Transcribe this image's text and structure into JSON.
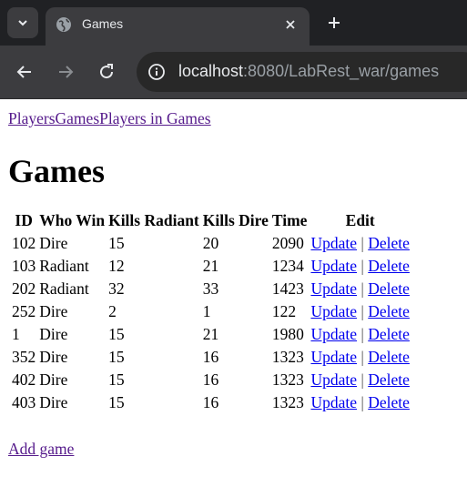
{
  "browser": {
    "tab_title": "Games",
    "url_host": "localhost",
    "url_rest": ":8080/LabRest_war/games"
  },
  "nav": {
    "players": "Players",
    "games": "Games",
    "players_in_games": "Players in Games"
  },
  "page_title": "Games",
  "table": {
    "headers": [
      "ID",
      "Who Win",
      "Kills Radiant",
      "Kills Dire",
      "Time",
      "Edit"
    ],
    "update_label": "Update",
    "delete_label": "Delete",
    "separator": "|",
    "rows": [
      {
        "id": "102",
        "who_win": "Dire",
        "kills_radiant": "15",
        "kills_dire": "20",
        "time": "2090"
      },
      {
        "id": "103",
        "who_win": "Radiant",
        "kills_radiant": "12",
        "kills_dire": "21",
        "time": "1234"
      },
      {
        "id": "202",
        "who_win": "Radiant",
        "kills_radiant": "32",
        "kills_dire": "33",
        "time": "1423"
      },
      {
        "id": "252",
        "who_win": "Dire",
        "kills_radiant": "2",
        "kills_dire": "1",
        "time": "122"
      },
      {
        "id": "1",
        "who_win": "Dire",
        "kills_radiant": "15",
        "kills_dire": "21",
        "time": "1980"
      },
      {
        "id": "352",
        "who_win": "Dire",
        "kills_radiant": "15",
        "kills_dire": "16",
        "time": "1323"
      },
      {
        "id": "402",
        "who_win": "Dire",
        "kills_radiant": "15",
        "kills_dire": "16",
        "time": "1323"
      },
      {
        "id": "403",
        "who_win": "Dire",
        "kills_radiant": "15",
        "kills_dire": "16",
        "time": "1323"
      }
    ]
  },
  "add_game_label": "Add game"
}
